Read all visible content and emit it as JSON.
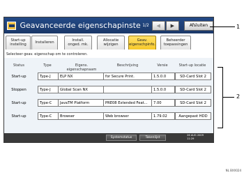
{
  "window": {
    "title": "Geavanceerde eigenschapinstellingen",
    "page_indicator": "1/2",
    "prev_icon": "◀",
    "next_icon": "▶",
    "close_label": "Afsluiten"
  },
  "tabs": [
    {
      "line1": "Start-up",
      "line2": "instelling",
      "active": false
    },
    {
      "line1": "Installeren",
      "line2": "",
      "active": false
    },
    {
      "line1": "Install.",
      "line2": "onged. mk.",
      "active": false
    },
    {
      "line1": "Allocatie",
      "line2": "wijzigen",
      "active": false
    },
    {
      "line1": "Geav.",
      "line2": "eigenschpinfo.",
      "active": true
    },
    {
      "line1": "Beheerder",
      "line2": "toepassingen",
      "active": false
    }
  ],
  "hint": "Selecteer geav. eigenschap om te controleren.",
  "table": {
    "headers": [
      "Status",
      "Type",
      "Eigens. eigenschapnaam",
      "Beschrijving",
      "Versie",
      "Start-up locatie"
    ],
    "rows": [
      {
        "status": "Start-up",
        "type": "Type-J",
        "name": "ELP NX",
        "description": "for Secure Print.",
        "version": "1.5.0.0",
        "location": "SD-Card Slot 2"
      },
      {
        "status": "Stoppen",
        "type": "Type-J",
        "name": "Global Scan NX",
        "description": "",
        "version": "1.5.0.0",
        "location": "SD-Card Slot 2"
      },
      {
        "status": "Start-up",
        "type": "Type-C",
        "name": "JavaTM Platform",
        "description": "PRE08 Extended Feat...",
        "version": "7.00",
        "location": "SD-Card Slot 2"
      },
      {
        "status": "Start-up",
        "type": "Type-C",
        "name": "Browser",
        "description": "Web browser",
        "version": "1.79.02",
        "location": "Aangepast HDD"
      }
    ]
  },
  "footer": {
    "system_status": "Systemstatus",
    "job_list": "Takenlijst",
    "date": "26 AUG 2009",
    "time": "11:29"
  },
  "callouts": [
    "1",
    "2"
  ],
  "image_code": "NL BXX024"
}
